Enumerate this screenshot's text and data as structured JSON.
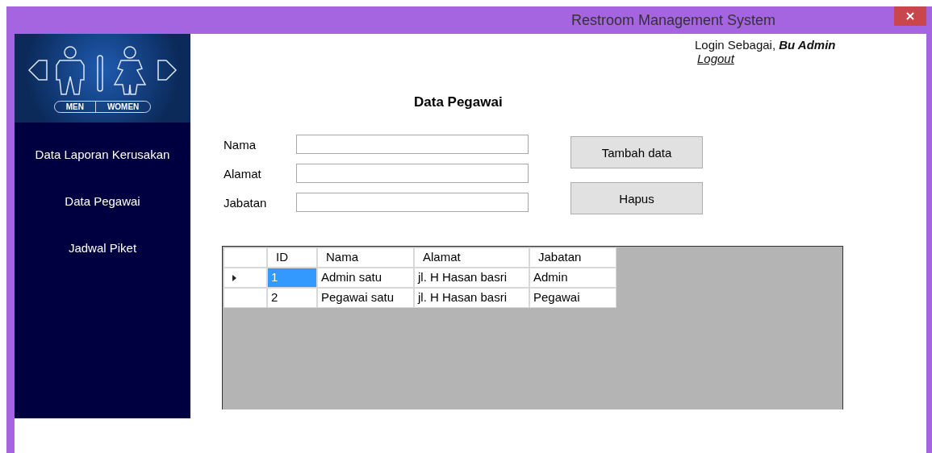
{
  "window": {
    "title": "Restroom Management System"
  },
  "logo": {
    "left_label": "MEN",
    "right_label": "WOMEN"
  },
  "sidebar": {
    "items": [
      {
        "label": "Data Laporan Kerusakan"
      },
      {
        "label": "Data Pegawai"
      },
      {
        "label": "Jadwal Piket"
      }
    ]
  },
  "header": {
    "login_text": "Login Sebagai, ",
    "user": "Bu Admin",
    "logout": "Logout"
  },
  "page_title": "Data Pegawai",
  "form": {
    "fields": [
      {
        "label": "Nama"
      },
      {
        "label": "Alamat"
      },
      {
        "label": "Jabatan"
      }
    ],
    "buttons": [
      "Tambah data",
      "Hapus"
    ]
  },
  "table": {
    "columns": [
      "ID",
      "Nama",
      "Alamat",
      "Jabatan"
    ],
    "rows": [
      {
        "selected": true,
        "cells": [
          "1",
          "Admin satu",
          "jl. H Hasan basri",
          "Admin"
        ]
      },
      {
        "selected": false,
        "cells": [
          "2",
          "Pegawai satu",
          "jl. H Hasan basri",
          "Pegawai"
        ]
      }
    ]
  }
}
